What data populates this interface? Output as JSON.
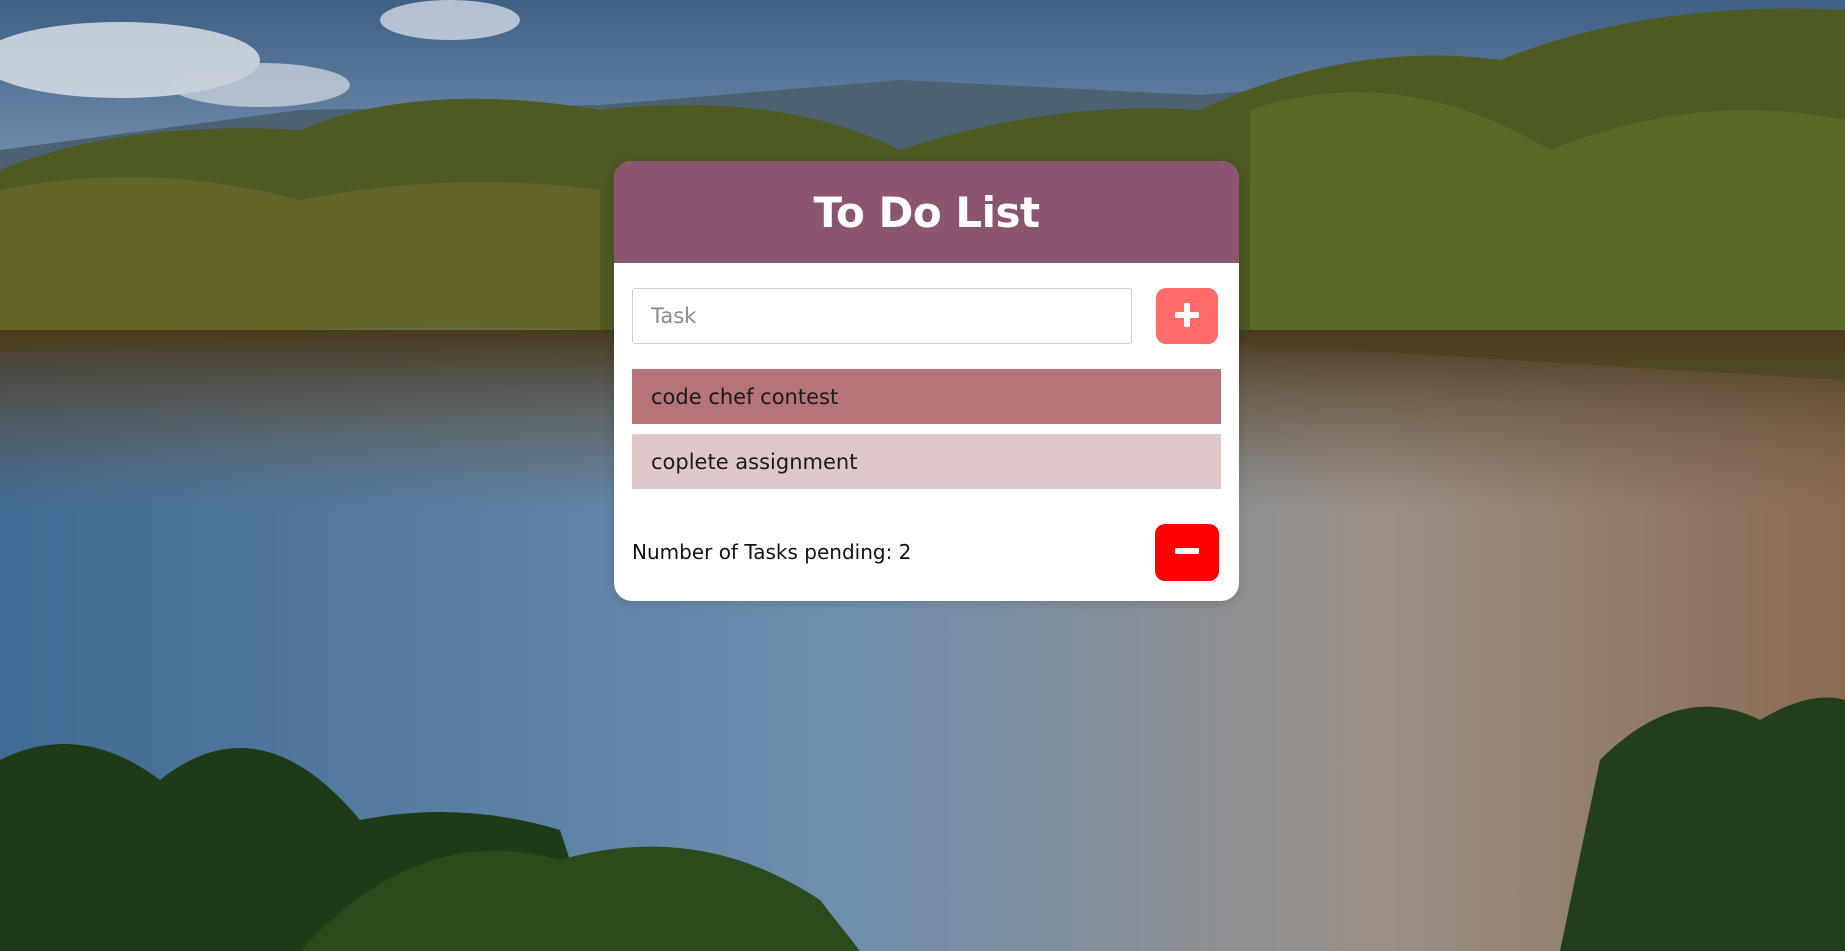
{
  "header": {
    "title": "To Do List"
  },
  "input": {
    "placeholder": "Task",
    "value": ""
  },
  "add_button": {
    "icon": "plus-icon"
  },
  "tasks": [
    {
      "label": "code chef contest",
      "state": "highlighted"
    },
    {
      "label": "coplete assignment",
      "state": "normal"
    }
  ],
  "footer": {
    "pending_label": "Number of Tasks pending: 2",
    "clear_button_icon": "minus-icon"
  },
  "colors": {
    "header_bg": "#8b5570",
    "add_button_bg": "#ff6b6b",
    "clear_button_bg": "#ff0000",
    "task_highlight_bg": "#b57478",
    "task_normal_bg": "#e0c7c9",
    "card_bg": "#ffffff"
  }
}
